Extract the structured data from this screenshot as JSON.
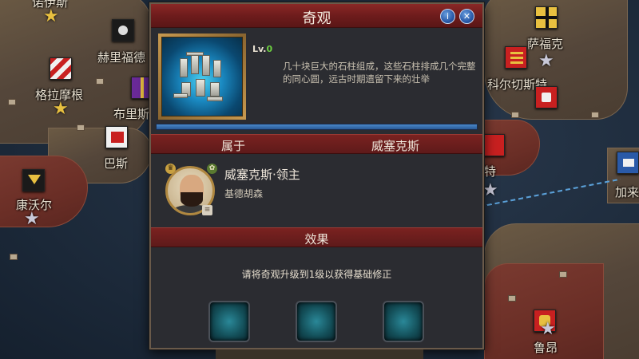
{
  "map": {
    "regions": [
      {
        "name": "诺伊斯",
        "partial": true
      },
      {
        "name": "赫里福德"
      },
      {
        "name": "格拉摩根"
      },
      {
        "name": "布里斯"
      },
      {
        "name": "巴斯"
      },
      {
        "name": "康沃尔"
      },
      {
        "name": "萨福克"
      },
      {
        "name": "科尔切斯特"
      },
      {
        "name": "特"
      },
      {
        "name": "加来"
      },
      {
        "name": "鲁昂"
      }
    ]
  },
  "dialog": {
    "title": "奇观",
    "info_btn": "i",
    "close_btn": "✕",
    "level_label": "Lv.",
    "level_value": "0",
    "description": "几十块巨大的石柱组成，这些石柱排成几个完整的同心圆，远古时期遗留下来的壮举",
    "belongs_label": "属于",
    "belongs_faction": "威塞克斯",
    "owner_name": "威塞克斯·领主",
    "owner_place": "基德胡森",
    "effect_label": "效果",
    "effect_text": "请将奇观升级到1级以获得基础修正",
    "slots": 3
  },
  "colors": {
    "title_red": "#7a2220",
    "level_green": "#6cd040",
    "slot_teal": "#2a8898"
  }
}
